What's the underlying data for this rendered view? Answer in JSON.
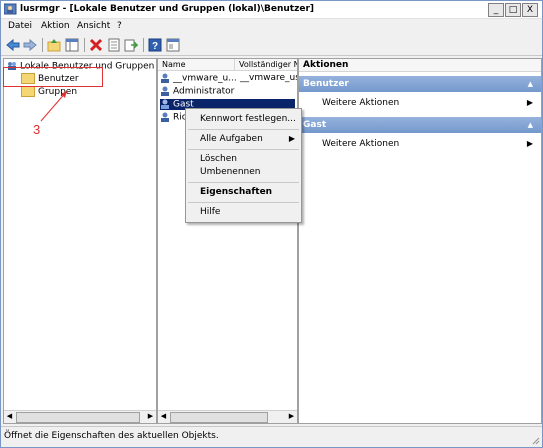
{
  "window": {
    "title": "lusrmgr - [Lokale Benutzer und Gruppen (lokal)\\Benutzer]",
    "min_label": "_",
    "max_label": "□",
    "close_label": "X"
  },
  "menu": [
    "Datei",
    "Aktion",
    "Ansicht",
    "?"
  ],
  "toolbar": {
    "icons": [
      "back-icon",
      "forward-icon",
      "up-icon",
      "show-tree-icon",
      "delete-icon",
      "properties-icon",
      "export-icon",
      "help-icon",
      "console-tree-icon"
    ]
  },
  "tree": {
    "root": "Lokale Benutzer und Gruppen (lokal)",
    "items": [
      "Benutzer",
      "Gruppen"
    ]
  },
  "annotation": {
    "number": "3",
    "color": "#e03030"
  },
  "list": {
    "columns": [
      "Name",
      "Vollständiger N"
    ],
    "rows": [
      {
        "name": "__vmware_u...",
        "full": "__vmware_use"
      },
      {
        "name": "Administrator",
        "full": ""
      },
      {
        "name": "Gast",
        "full": ""
      },
      {
        "name": "Ric",
        "full": ""
      }
    ],
    "selected_color": "#0a246a"
  },
  "actions": {
    "title": "Aktionen",
    "sections": [
      {
        "header": "Benutzer",
        "item": "Weitere Aktionen"
      },
      {
        "header": "Gast",
        "item": "Weitere Aktionen"
      }
    ]
  },
  "context_menu": {
    "items": [
      "Kennwort festlegen...",
      "Alle Aufgaben",
      "Löschen",
      "Umbenennen",
      "Eigenschaften",
      "Hilfe"
    ]
  },
  "status": "Öffnet die Eigenschaften des aktuellen Objekts."
}
